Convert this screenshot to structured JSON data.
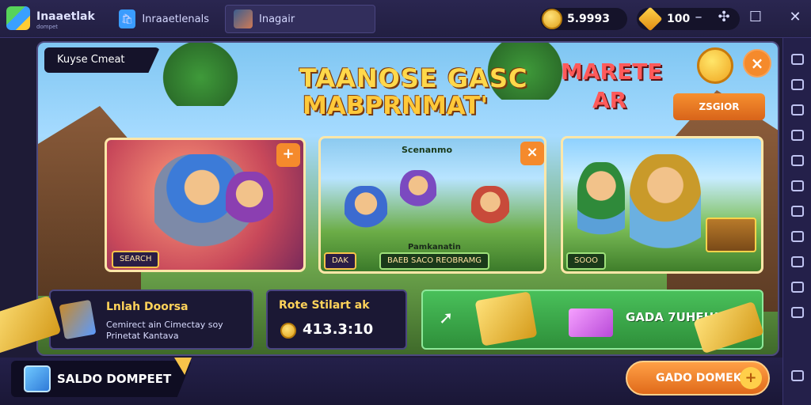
{
  "app": {
    "title": "Inaaetlak",
    "subtitle": "dompet",
    "tabs": [
      {
        "label": "Inraaetlenals",
        "icon": "app-store-icon"
      },
      {
        "label": "Inagair",
        "icon": "game-thumbnail-icon"
      }
    ]
  },
  "wallet": {
    "coins": "5.9993",
    "gems": "100"
  },
  "window_controls": [
    "minimize-icon",
    "pin-icon",
    "maximize-icon",
    "close-icon"
  ],
  "banner": {
    "badge": "Kuyse Cmeat",
    "headline_line1": "TAANOSE GASC",
    "headline_line2": "MABPRNMAT'",
    "market_line1": "MARETE",
    "market_line2": "AR",
    "register_label": "ZSGIOR",
    "close_label": "×"
  },
  "cards": [
    {
      "tag": "SEARCH",
      "corner": "+"
    },
    {
      "title": "Scenanmo",
      "caption": "Pamkanatin",
      "footer_left": "DAK",
      "footer_right": "BAEB SACO REOBRAMG",
      "corner": "×"
    },
    {
      "tag": "SOOO"
    }
  ],
  "panels": {
    "left_title": "Lnlah Doorsa",
    "left_sub1": "Cemirect ain Cimectay soy",
    "left_sub2": "Prinetat Kantava",
    "mid_title": "Rote Stilart ak",
    "mid_value": "413.3:10",
    "green_label": "GADA 7UHEH!"
  },
  "bottom": {
    "wallet_label": "SALDO DOMPEET",
    "cta_label": "GADO DOMEKI",
    "cta_icon": "+"
  },
  "colors": {
    "accent": "#f58a2c",
    "gold": "#ffd84a",
    "green": "#49c05a",
    "dark": "#1e1b36"
  }
}
